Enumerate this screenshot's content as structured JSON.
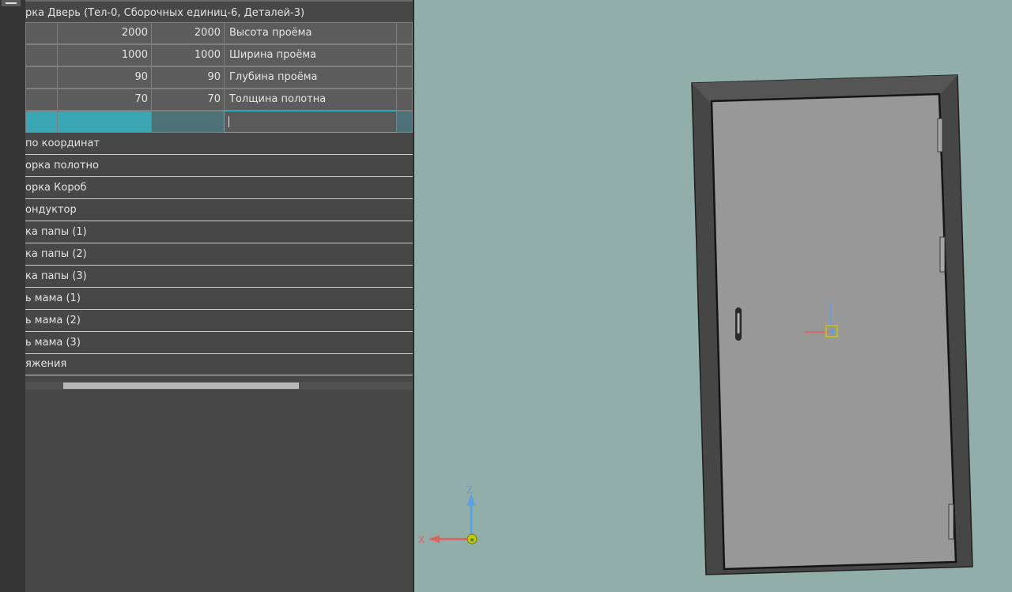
{
  "panel": {
    "title": "рка Дверь (Тел-0, Сборочных единиц-6, Деталей-3)",
    "grid": [
      {
        "value1": "2000",
        "value2": "2000",
        "name": "Высота проёма"
      },
      {
        "value1": "1000",
        "value2": "1000",
        "name": " Ширина проёма"
      },
      {
        "value1": "90",
        "value2": "90",
        "name": "Глубина проёма"
      },
      {
        "value1": "70",
        "value2": "70",
        "name": "Толщина полотна"
      }
    ],
    "tree_items": [
      "по координат",
      "орка полотно",
      "орка Короб",
      "ондуктор",
      "ка папы (1)",
      "ка папы (2)",
      "ка папы (3)",
      "ь мама (1)",
      "ь мама (2)",
      "ь мама (3)",
      "яжения"
    ]
  },
  "viewport": {
    "background": "#92aea9",
    "axis_x_label": "X",
    "axis_z_label": "Z",
    "axis_x_color": "#e06060",
    "axis_z_color": "#5aa0e8",
    "origin_color": "#c8c800"
  }
}
